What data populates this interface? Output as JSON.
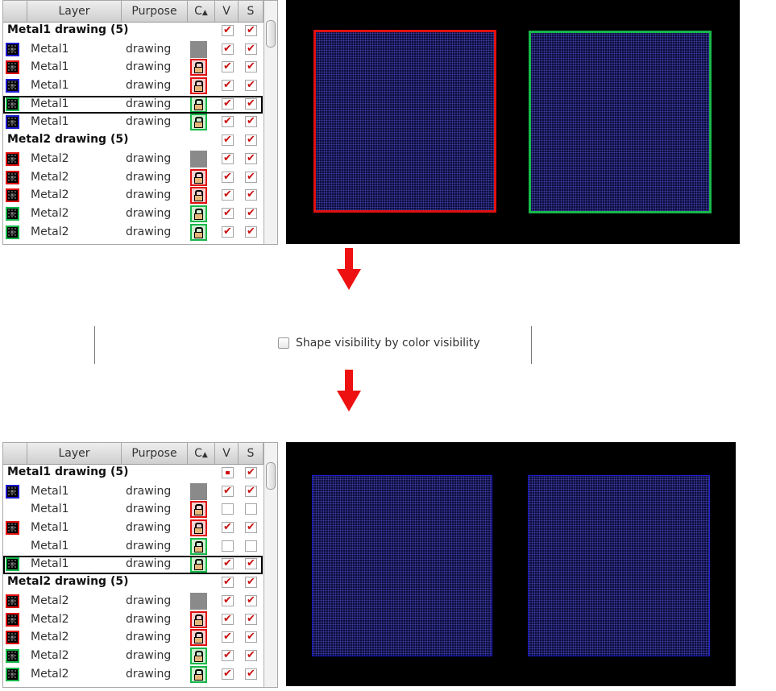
{
  "headers": {
    "layer": "Layer",
    "purpose": "Purpose",
    "color": "C",
    "visible": "V",
    "selectable": "S"
  },
  "top_panel": {
    "rows": [
      {
        "type": "group",
        "title": "Metal1 drawing (5)",
        "v": "checked",
        "s": "checked"
      },
      {
        "type": "item",
        "layer": "Metal1",
        "purpose": "drawing",
        "color": "#1c1cd0",
        "icon": "gray",
        "v": "checked",
        "s": "checked"
      },
      {
        "type": "item",
        "layer": "Metal1",
        "purpose": "drawing",
        "color": "#e01010",
        "icon": "red",
        "v": "checked",
        "s": "checked"
      },
      {
        "type": "item",
        "layer": "Metal1",
        "purpose": "drawing",
        "color": "#1c1cd0",
        "icon": "red",
        "v": "checked",
        "s": "checked"
      },
      {
        "type": "item",
        "layer": "Metal1",
        "purpose": "drawing",
        "color": "#17b74a",
        "icon": "green",
        "v": "checked",
        "s": "checked",
        "highlight": true
      },
      {
        "type": "item",
        "layer": "Metal1",
        "purpose": "drawing",
        "color": "#1c1cd0",
        "icon": "green",
        "v": "checked",
        "s": "checked"
      },
      {
        "type": "group",
        "title": "Metal2 drawing (5)",
        "v": "checked",
        "s": "checked"
      },
      {
        "type": "item",
        "layer": "Metal2",
        "purpose": "drawing",
        "color": "#e01010",
        "icon": "gray",
        "v": "checked",
        "s": "checked"
      },
      {
        "type": "item",
        "layer": "Metal2",
        "purpose": "drawing",
        "color": "#e01010",
        "icon": "red",
        "v": "checked",
        "s": "checked"
      },
      {
        "type": "item",
        "layer": "Metal2",
        "purpose": "drawing",
        "color": "#e01010",
        "icon": "red",
        "v": "checked",
        "s": "checked"
      },
      {
        "type": "item",
        "layer": "Metal2",
        "purpose": "drawing",
        "color": "#17b74a",
        "icon": "green",
        "v": "checked",
        "s": "checked"
      },
      {
        "type": "item",
        "layer": "Metal2",
        "purpose": "drawing",
        "color": "#17b74a",
        "icon": "green",
        "v": "checked",
        "s": "checked"
      }
    ]
  },
  "bottom_panel": {
    "rows": [
      {
        "type": "group",
        "title": "Metal1 drawing (5)",
        "v": "partial",
        "s": "checked"
      },
      {
        "type": "item",
        "layer": "Metal1",
        "purpose": "drawing",
        "color": "#1c1cd0",
        "icon": "gray",
        "v": "checked",
        "s": "checked"
      },
      {
        "type": "item",
        "layer": "Metal1",
        "purpose": "drawing",
        "color": "",
        "icon": "red",
        "v": "unchecked",
        "s": "unchecked"
      },
      {
        "type": "item",
        "layer": "Metal1",
        "purpose": "drawing",
        "color": "#e01010",
        "icon": "red",
        "v": "checked",
        "s": "checked"
      },
      {
        "type": "item",
        "layer": "Metal1",
        "purpose": "drawing",
        "color": "",
        "icon": "green",
        "v": "unchecked",
        "s": "unchecked"
      },
      {
        "type": "item",
        "layer": "Metal1",
        "purpose": "drawing",
        "color": "#17b74a",
        "icon": "green",
        "v": "checked",
        "s": "checked",
        "highlight": true
      },
      {
        "type": "group",
        "title": "Metal2 drawing (5)",
        "v": "checked",
        "s": "checked"
      },
      {
        "type": "item",
        "layer": "Metal2",
        "purpose": "drawing",
        "color": "#e01010",
        "icon": "gray",
        "v": "checked",
        "s": "checked"
      },
      {
        "type": "item",
        "layer": "Metal2",
        "purpose": "drawing",
        "color": "#e01010",
        "icon": "red",
        "v": "checked",
        "s": "checked"
      },
      {
        "type": "item",
        "layer": "Metal2",
        "purpose": "drawing",
        "color": "#e01010",
        "icon": "red",
        "v": "checked",
        "s": "checked"
      },
      {
        "type": "item",
        "layer": "Metal2",
        "purpose": "drawing",
        "color": "#17b74a",
        "icon": "green",
        "v": "checked",
        "s": "checked"
      },
      {
        "type": "item",
        "layer": "Metal2",
        "purpose": "drawing",
        "color": "#17b74a",
        "icon": "green",
        "v": "checked",
        "s": "checked"
      }
    ]
  },
  "option": {
    "label": "Shape visibility by color visibility",
    "checked": false
  },
  "colors": {
    "red": "#e01010",
    "green": "#17b74a",
    "blue": "#1c1cd0",
    "arrow": "#ee1111",
    "canvas_bg": "#000000"
  },
  "canvas_top": {
    "left_shape_outline": "red",
    "right_shape_outline": "green"
  },
  "canvas_bottom": {
    "left_shape_outline": "blue",
    "right_shape_outline": "blue"
  }
}
